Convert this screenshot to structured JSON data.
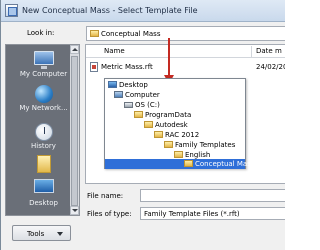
{
  "window": {
    "title": "New Conceptual Mass - Select Template File"
  },
  "lookin": {
    "label": "Look in:",
    "value": "Conceptual Mass"
  },
  "places": {
    "items": [
      {
        "label": "My Computer",
        "icon": "computer-icon"
      },
      {
        "label": "My Network...",
        "icon": "network-icon"
      },
      {
        "label": "History",
        "icon": "history-icon"
      },
      {
        "label": "",
        "icon": "folder-icon"
      },
      {
        "label": "Desktop",
        "icon": "desktop-icon"
      }
    ]
  },
  "filelist": {
    "columns": {
      "name": "Name",
      "date": "Date m"
    },
    "files": [
      {
        "name": "Metric Mass.rft",
        "date": "24/02/20"
      }
    ]
  },
  "tree": {
    "items": [
      {
        "label": "Desktop",
        "icon": "desktop-icon"
      },
      {
        "label": "Computer",
        "icon": "computer-icon"
      },
      {
        "label": "OS (C:)",
        "icon": "drive-icon"
      },
      {
        "label": "ProgramData",
        "icon": "folder-icon"
      },
      {
        "label": "Autodesk",
        "icon": "folder-icon"
      },
      {
        "label": "RAC 2012",
        "icon": "folder-icon"
      },
      {
        "label": "Family Templates",
        "icon": "folder-icon"
      },
      {
        "label": "English",
        "icon": "folder-icon"
      },
      {
        "label": "Conceptual Mass",
        "icon": "folder-icon",
        "selected": true
      }
    ]
  },
  "bottom": {
    "file_name_label": "File name:",
    "file_name_value": "",
    "files_of_type_label": "Files of type:",
    "files_of_type_value": "Family Template Files  (*.rft)"
  },
  "tools": {
    "label": "Tools"
  },
  "colors": {
    "selection": "#2f6fd8",
    "annotation_arrow": "#c42a22",
    "places_bg": "#6a6f78"
  }
}
